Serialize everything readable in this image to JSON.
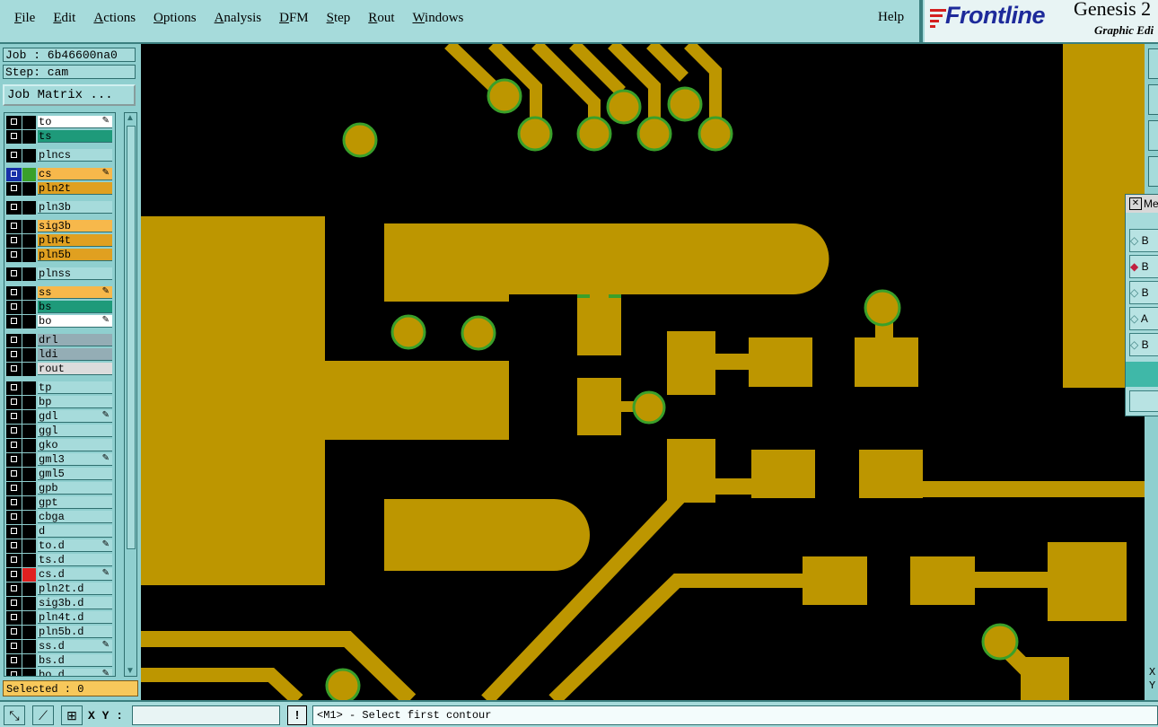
{
  "menubar": {
    "items": [
      "File",
      "Edit",
      "Actions",
      "Options",
      "Analysis",
      "DFM",
      "Step",
      "Rout",
      "Windows"
    ],
    "help": "Help"
  },
  "brand": {
    "name": "Frontline",
    "title": "Genesis 2",
    "subtitle": "Graphic Edi"
  },
  "left": {
    "job": "Job : 6b46600na0",
    "step": "Step: cam",
    "job_matrix": "Job Matrix ...",
    "selected": "Selected : 0"
  },
  "layers": [
    {
      "name": "to",
      "color": "#ffffff",
      "mark": "edit"
    },
    {
      "name": "ts",
      "color": "#1e9a7a",
      "mark": ""
    },
    {
      "name": "plncs",
      "color": "#a6dbdb",
      "mark": ""
    },
    {
      "name": "cs",
      "color": "#f7b84b",
      "mark": "edit",
      "active": true,
      "swatch": "#3aa02a"
    },
    {
      "name": "pln2t",
      "color": "#e0a020",
      "mark": ""
    },
    {
      "name": "pln3b",
      "color": "#a6dbdb",
      "mark": ""
    },
    {
      "name": "sig3b",
      "color": "#f7b84b",
      "mark": ""
    },
    {
      "name": "pln4t",
      "color": "#e0a020",
      "mark": ""
    },
    {
      "name": "pln5b",
      "color": "#e0a020",
      "mark": ""
    },
    {
      "name": "plnss",
      "color": "#a6dbdb",
      "mark": ""
    },
    {
      "name": "ss",
      "color": "#f7b84b",
      "mark": "edit"
    },
    {
      "name": "bs",
      "color": "#1e9a7a",
      "mark": ""
    },
    {
      "name": "bo",
      "color": "#ffffff",
      "mark": "edit"
    },
    {
      "name": "drl",
      "color": "#94adb5",
      "mark": ""
    },
    {
      "name": "ldi",
      "color": "#94adb5",
      "mark": ""
    },
    {
      "name": "rout",
      "color": "#dcdcdc",
      "mark": ""
    },
    {
      "name": "tp",
      "color": "#a6dbdb",
      "mark": ""
    },
    {
      "name": "bp",
      "color": "#a6dbdb",
      "mark": ""
    },
    {
      "name": "gdl",
      "color": "#a6dbdb",
      "mark": "edit"
    },
    {
      "name": "ggl",
      "color": "#a6dbdb",
      "mark": ""
    },
    {
      "name": "gko",
      "color": "#a6dbdb",
      "mark": ""
    },
    {
      "name": "gml3",
      "color": "#a6dbdb",
      "mark": "edit"
    },
    {
      "name": "gml5",
      "color": "#a6dbdb",
      "mark": ""
    },
    {
      "name": "gpb",
      "color": "#a6dbdb",
      "mark": ""
    },
    {
      "name": "gpt",
      "color": "#a6dbdb",
      "mark": ""
    },
    {
      "name": "cbga",
      "color": "#a6dbdb",
      "mark": ""
    },
    {
      "name": "d",
      "color": "#a6dbdb",
      "mark": ""
    },
    {
      "name": "to.d",
      "color": "#a6dbdb",
      "mark": "edit"
    },
    {
      "name": "ts.d",
      "color": "#a6dbdb",
      "mark": ""
    },
    {
      "name": "cs.d",
      "color": "#a6dbdb",
      "mark": "edit",
      "swatch": "#e02020"
    },
    {
      "name": "pln2t.d",
      "color": "#a6dbdb",
      "mark": ""
    },
    {
      "name": "sig3b.d",
      "color": "#a6dbdb",
      "mark": ""
    },
    {
      "name": "pln4t.d",
      "color": "#a6dbdb",
      "mark": ""
    },
    {
      "name": "pln5b.d",
      "color": "#a6dbdb",
      "mark": ""
    },
    {
      "name": "ss.d",
      "color": "#a6dbdb",
      "mark": "edit"
    },
    {
      "name": "bs.d",
      "color": "#a6dbdb",
      "mark": ""
    },
    {
      "name": "bo.d",
      "color": "#a6dbdb",
      "mark": "edit"
    }
  ],
  "floatwin": {
    "title": "Me",
    "options": [
      "B",
      "B",
      "B",
      "A",
      "B"
    ]
  },
  "status": {
    "xy_label": "X Y :",
    "xy_value": "",
    "warn": "!",
    "prompt": "<M1> - Select first contour"
  },
  "readout": {
    "x": "X",
    "y": "Y"
  },
  "colors": {
    "copper": "#bd9600",
    "pad_outline": "#3aa02a",
    "background": "#000000",
    "panel": "#a6dbdb"
  }
}
